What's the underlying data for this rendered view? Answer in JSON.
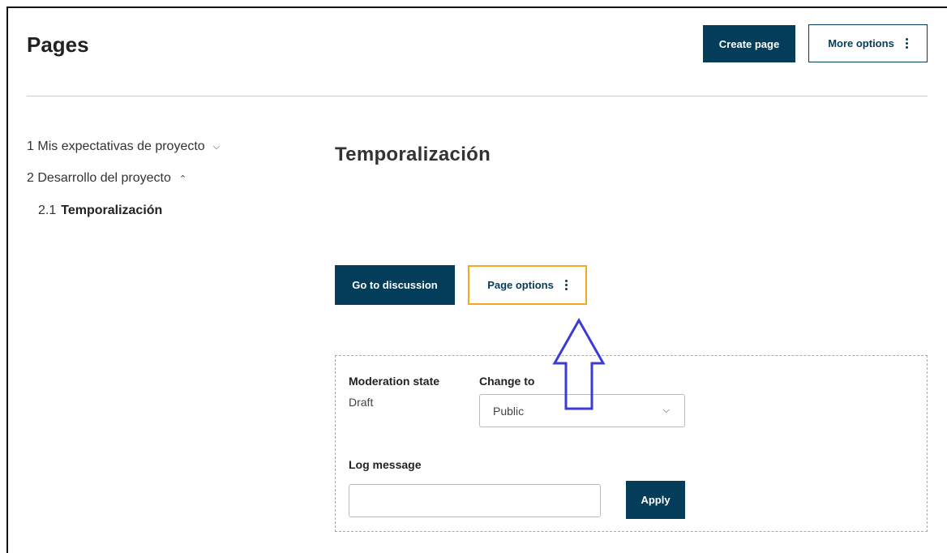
{
  "header": {
    "title": "Pages",
    "create_label": "Create page",
    "more_label": "More options"
  },
  "nav": {
    "items": [
      {
        "number": "1",
        "label": "Mis expectativas de proyecto",
        "chevron": "chevron-down-icon"
      },
      {
        "number": "2",
        "label": "Desarrollo del proyecto",
        "chevron": "chevron-up-icon"
      },
      {
        "number": "2.1",
        "label": "Temporalización"
      }
    ]
  },
  "content": {
    "title": "Temporalización",
    "discussion_label": "Go to discussion",
    "page_options_label": "Page options"
  },
  "moderation": {
    "state_label": "Moderation state",
    "state_value": "Draft",
    "change_label": "Change to",
    "change_value": "Public",
    "log_label": "Log message",
    "log_value": "",
    "apply_label": "Apply"
  },
  "colors": {
    "primary": "#033d5a",
    "highlight": "#f5a623",
    "annotation": "#3b3bd6"
  }
}
